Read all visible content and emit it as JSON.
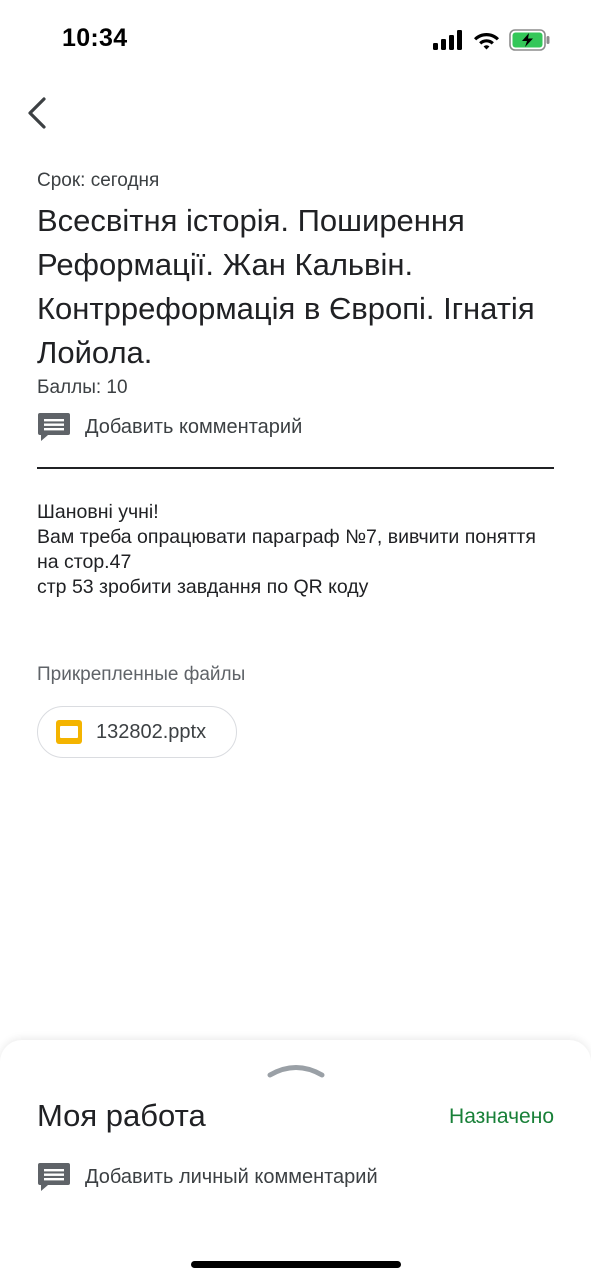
{
  "status_bar": {
    "time": "10:34",
    "icons": [
      "signal-icon",
      "wifi-icon",
      "battery-charging-icon"
    ]
  },
  "assignment": {
    "due": "Срок: сегодня",
    "title": "Всесвітня історія.  Поширення Реформації. Жан Кальвін. Контрреформація в Європі. Ігнатія Лойола.",
    "points": "Баллы: 10",
    "add_comment_label": "Добавить комментарий",
    "description": "Шановні учні!\n Вам треба опрацювати параграф  №7, вивчити поняття на стор.47\nстр 53 зробити завдання по QR коду"
  },
  "attachments": {
    "header": "Прикрепленные файлы",
    "files": [
      {
        "name": "132802.pptx",
        "icon": "slides-file-icon",
        "icon_color": "#f4b400"
      }
    ]
  },
  "my_work": {
    "title": "Моя работа",
    "status": "Назначено",
    "status_color": "#188038",
    "add_private_comment_label": "Добавить личный комментарий"
  }
}
